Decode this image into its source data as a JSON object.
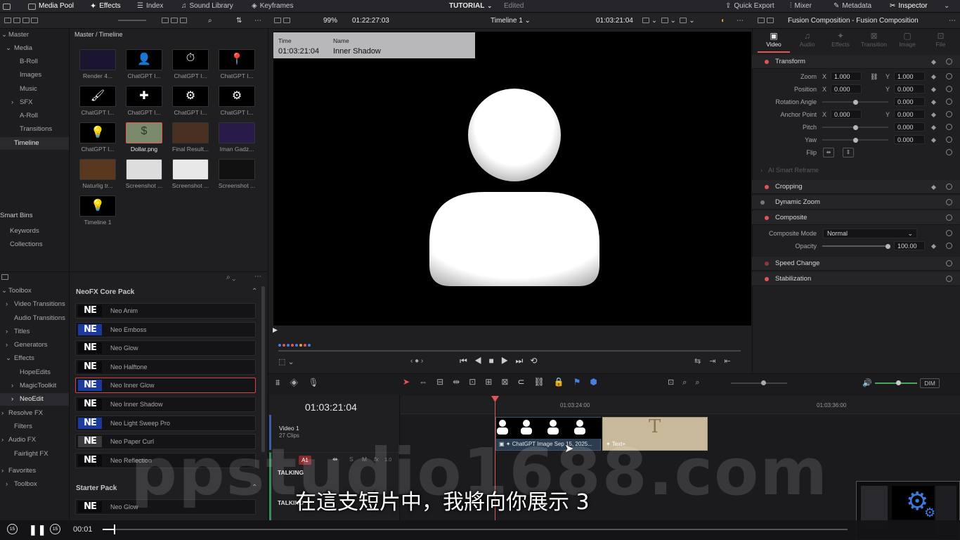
{
  "topbar": {
    "media_pool": "Media Pool",
    "effects": "Effects",
    "index": "Index",
    "sound_library": "Sound Library",
    "keyframes": "Keyframes",
    "project_title": "TUTORIAL",
    "project_status": "Edited",
    "quick_export": "Quick Export",
    "mixer": "Mixer",
    "metadata": "Metadata",
    "inspector": "Inspector"
  },
  "toolbar2": {
    "zoom": "99%",
    "source_timecode": "01:22:27:03",
    "timeline_name": "Timeline 1",
    "record_timecode": "01:03:21:04",
    "inspector_title": "Fusion Composition - Fusion Composition"
  },
  "media_tree": {
    "items": [
      "Master",
      "Media",
      "B-Roll",
      "Images",
      "Music",
      "SFX",
      "A-Roll",
      "Transitions",
      "Timeline"
    ],
    "smart_bins": "Smart Bins",
    "smart_items": [
      "Keywords",
      "Collections"
    ]
  },
  "media_pool": {
    "breadcrumb": "Master / Timeline",
    "clips": [
      "Render 4...",
      "ChatGPT I...",
      "ChatGPT I...",
      "ChatGPT I...",
      "ChatGPT I...",
      "ChatGPT I...",
      "ChatGPT I...",
      "ChatGPT I...",
      "ChatGPT I...",
      "Dollar.png",
      "Final Result...",
      "Iman Gadz...",
      "Naturlig tr...",
      "Screenshot ...",
      "Screenshot ...",
      "Screenshot ...",
      "Timeline 1"
    ]
  },
  "effects_tree": {
    "items": [
      "Toolbox",
      "Video Transitions",
      "Audio Transitions",
      "Titles",
      "Generators",
      "Effects",
      "HopeEdits",
      "MagicToolkit",
      "NeoEdit",
      "Resolve FX",
      "Filters",
      "Audio FX",
      "Fairlight FX"
    ],
    "favorites": "Favorites",
    "fav_items": [
      "Toolbox"
    ]
  },
  "effects_list": {
    "pack1": "NeoFX Core Pack",
    "items": [
      "Neo Anim",
      "Neo Emboss",
      "Neo Glow",
      "Neo Halftone",
      "Neo Inner Glow",
      "Neo Inner Shadow",
      "Neo Light Sweep Pro",
      "Neo Paper Curl",
      "Neo Reflection"
    ],
    "pack2": "Starter Pack",
    "items2": [
      "Neo Glow"
    ],
    "logo_text": "NE"
  },
  "viewer": {
    "time_label": "Time",
    "time_value": "01:03:21:04",
    "name_label": "Name",
    "name_value": "Inner Shadow"
  },
  "timeline": {
    "timecode": "01:03:21:04",
    "ruler": [
      "01:03:24:00",
      "01:03:36:00"
    ],
    "video_track": "Video 1",
    "video_clips_count": "27 Clips",
    "clip1": "ChatGPT Image Sep 15, 2025...",
    "clip2": "Text+",
    "text_glyph": "T",
    "audio_track_id": "A1",
    "audio_s": "S",
    "audio_m": "M",
    "audio_fx": "fx",
    "audio_level": "1.0",
    "audio_name1": "TALKING",
    "audio_name2": "TALKING",
    "dim": "DIM"
  },
  "inspector": {
    "tabs": [
      "Video",
      "Audio",
      "Effects",
      "Transition",
      "Image",
      "File"
    ],
    "transform": "Transform",
    "zoom_label": "Zoom",
    "zoom_x": "1.000",
    "zoom_y": "1.000",
    "position_label": "Position",
    "position_x": "0.000",
    "position_y": "0.000",
    "rotation_label": "Rotation Angle",
    "rotation_value": "0.000",
    "anchor_label": "Anchor Point",
    "anchor_x": "0.000",
    "anchor_y": "0.000",
    "pitch_label": "Pitch",
    "pitch_value": "0.000",
    "yaw_label": "Yaw",
    "yaw_value": "0.000",
    "flip_label": "Flip",
    "x_label": "X",
    "y_label": "Y",
    "ai_smart_reframe": "AI Smart Reframe",
    "cropping": "Cropping",
    "dynamic_zoom": "Dynamic Zoom",
    "composite": "Composite",
    "composite_mode_label": "Composite Mode",
    "composite_mode_value": "Normal",
    "opacity_label": "Opacity",
    "opacity_value": "100.00",
    "speed_change": "Speed Change",
    "stabilization": "Stabilization"
  },
  "overlay": {
    "subtitle": "在這支短片中，我將向你展示 3",
    "watermark": "ppstudio1688.com",
    "player_time": "00:01",
    "skip_back": "15",
    "skip_forward": "15"
  }
}
